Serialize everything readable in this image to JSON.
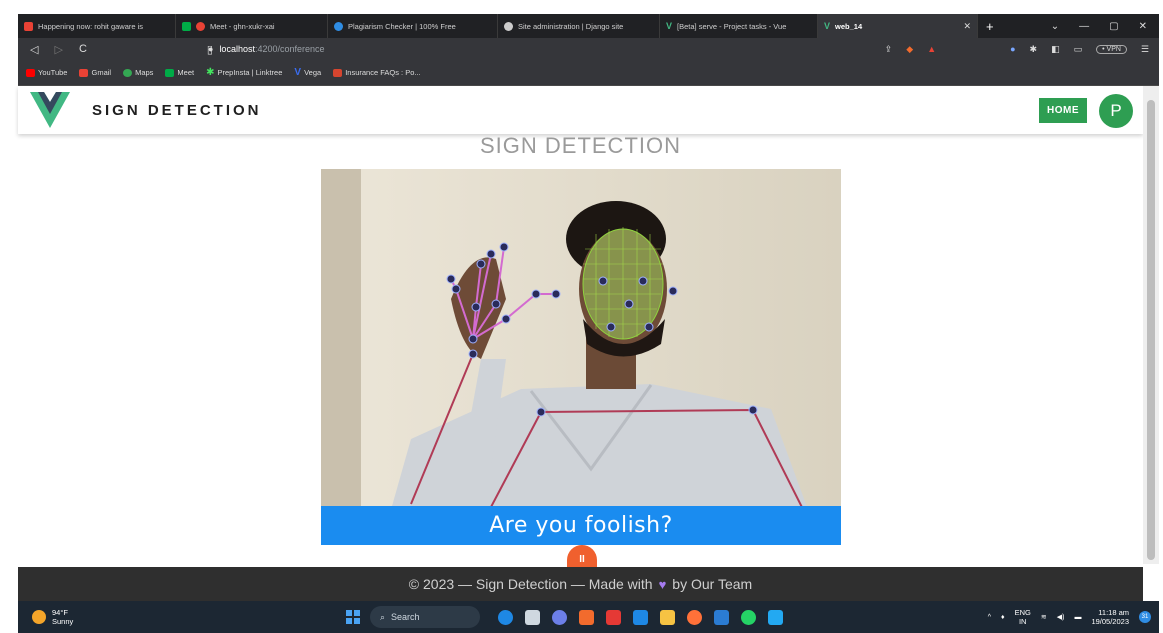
{
  "browser": {
    "tabs": [
      {
        "label": "Happening now: rohit gaware is",
        "color": "#e94235"
      },
      {
        "label": "Meet - ghn-xukr-xai",
        "color": "#00ac47"
      },
      {
        "label": "Plagiarism Checker | 100% Free",
        "color": "#2f8de4"
      },
      {
        "label": "Site administration | Django site",
        "color": "#cccccc"
      },
      {
        "label": "[Beta] serve - Project tasks - Vue",
        "color": "#42b883"
      },
      {
        "label": "web_14",
        "color": "#42b883",
        "active": true
      }
    ],
    "new_tab": "+",
    "url_host": "localhost",
    "url_path": ":4200/conference",
    "vpn_label": "• VPN",
    "bookmarks": [
      {
        "label": "YouTube",
        "color": "#ff0000"
      },
      {
        "label": "Gmail",
        "color": "#e94235"
      },
      {
        "label": "Maps",
        "color": "#34a853"
      },
      {
        "label": "Meet",
        "color": "#00ac47"
      },
      {
        "label": "PrepInsta | Linktree",
        "color": "#43e55e"
      },
      {
        "label": "Vega",
        "color": "#3a6df0"
      },
      {
        "label": "Insurance FAQs : Po...",
        "color": "#d6452f"
      }
    ]
  },
  "header": {
    "brand": "SIGN DETECTION",
    "home_label": "HOME",
    "avatar_letter": "P",
    "accent": "#2e9e52"
  },
  "main": {
    "title": "SIGN DETECTION",
    "caption": "Are you foolish?",
    "pause_icon": "II",
    "caption_color": "#1a8cf0"
  },
  "footer": {
    "prefix": "© 2023 — Sign Detection — Made with",
    "suffix": "by Our Team"
  },
  "taskbar": {
    "temp": "94°F",
    "condition": "Sunny",
    "search_label": "Search",
    "lang_top": "ENG",
    "lang_bottom": "IN",
    "time": "11:18 am",
    "date": "19/05/2023",
    "notifications": "31"
  }
}
